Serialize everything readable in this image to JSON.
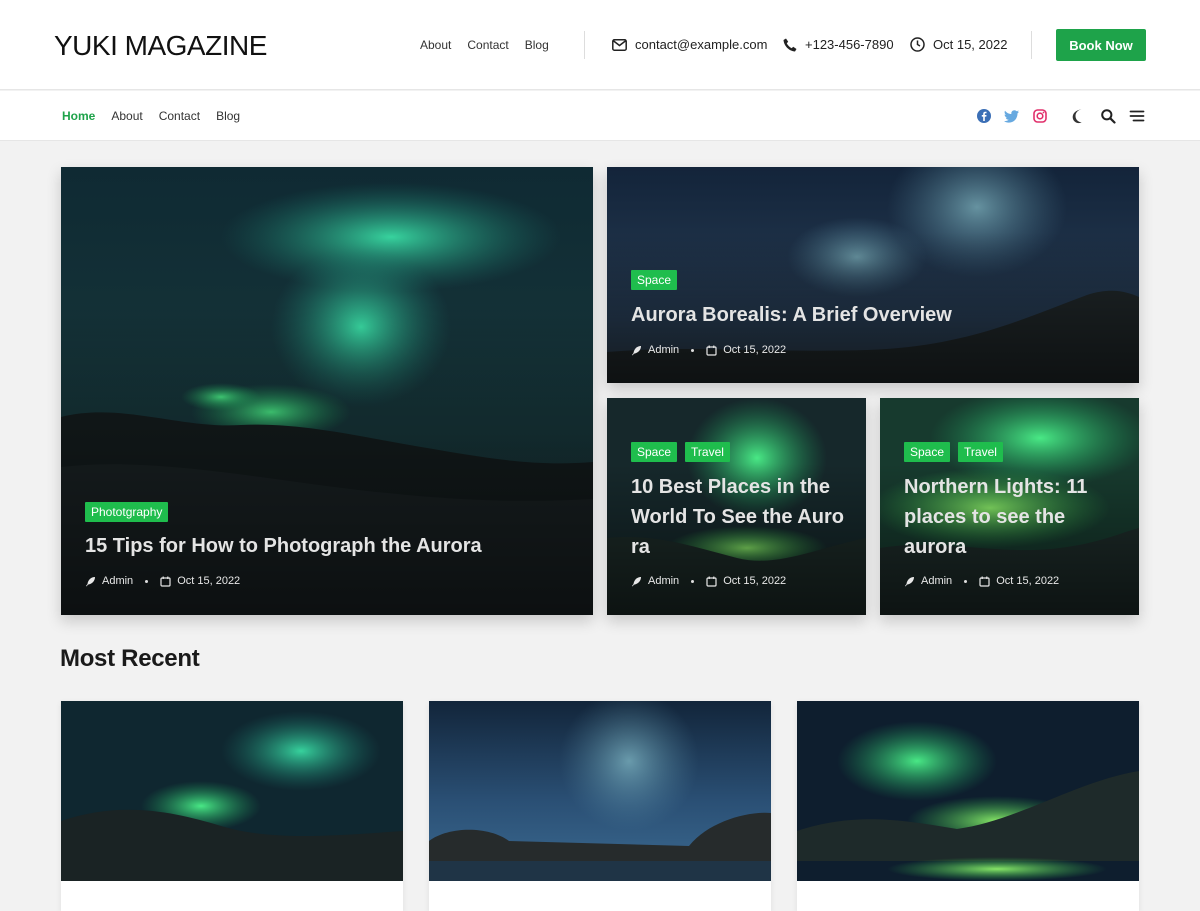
{
  "header": {
    "logo": "YUKI MAGAZINE",
    "top_nav": [
      "About",
      "Contact",
      "Blog"
    ],
    "email": "contact@example.com",
    "phone": "+123-456-7890",
    "date": "Oct 15, 2022",
    "book_button": "Book Now"
  },
  "nav": {
    "items": [
      "Home",
      "About",
      "Contact",
      "Blog"
    ],
    "active": "Home",
    "social_icons": [
      "facebook-icon",
      "twitter-icon",
      "instagram-icon"
    ],
    "tool_icons": [
      "moon-icon",
      "search-icon",
      "menu-icon"
    ]
  },
  "colors": {
    "accent": "#1ea34a",
    "tag": "#1fbd4d",
    "facebook": "#3b6fb6",
    "twitter": "#67a9e0",
    "instagram": "#e1306c"
  },
  "featured": [
    {
      "tags": [
        "Phototgraphy"
      ],
      "title": "15 Tips for How to Photograph the Aurora",
      "author": "Admin",
      "date": "Oct 15, 2022"
    },
    {
      "tags": [
        "Space"
      ],
      "title": "Aurora Borealis: A Brief Overview",
      "author": "Admin",
      "date": "Oct 15, 2022"
    },
    {
      "tags": [
        "Space",
        "Travel"
      ],
      "title_lines": [
        "10 Best Places in the",
        "World To See the Auro",
        "ra"
      ],
      "author": "Admin",
      "date": "Oct 15, 2022"
    },
    {
      "tags": [
        "Space",
        "Travel"
      ],
      "title_lines": [
        "Northern Lights: 11",
        "places to see the",
        "aurora"
      ],
      "author": "Admin",
      "date": "Oct 15, 2022"
    }
  ],
  "most_recent": {
    "title": "Most Recent"
  }
}
